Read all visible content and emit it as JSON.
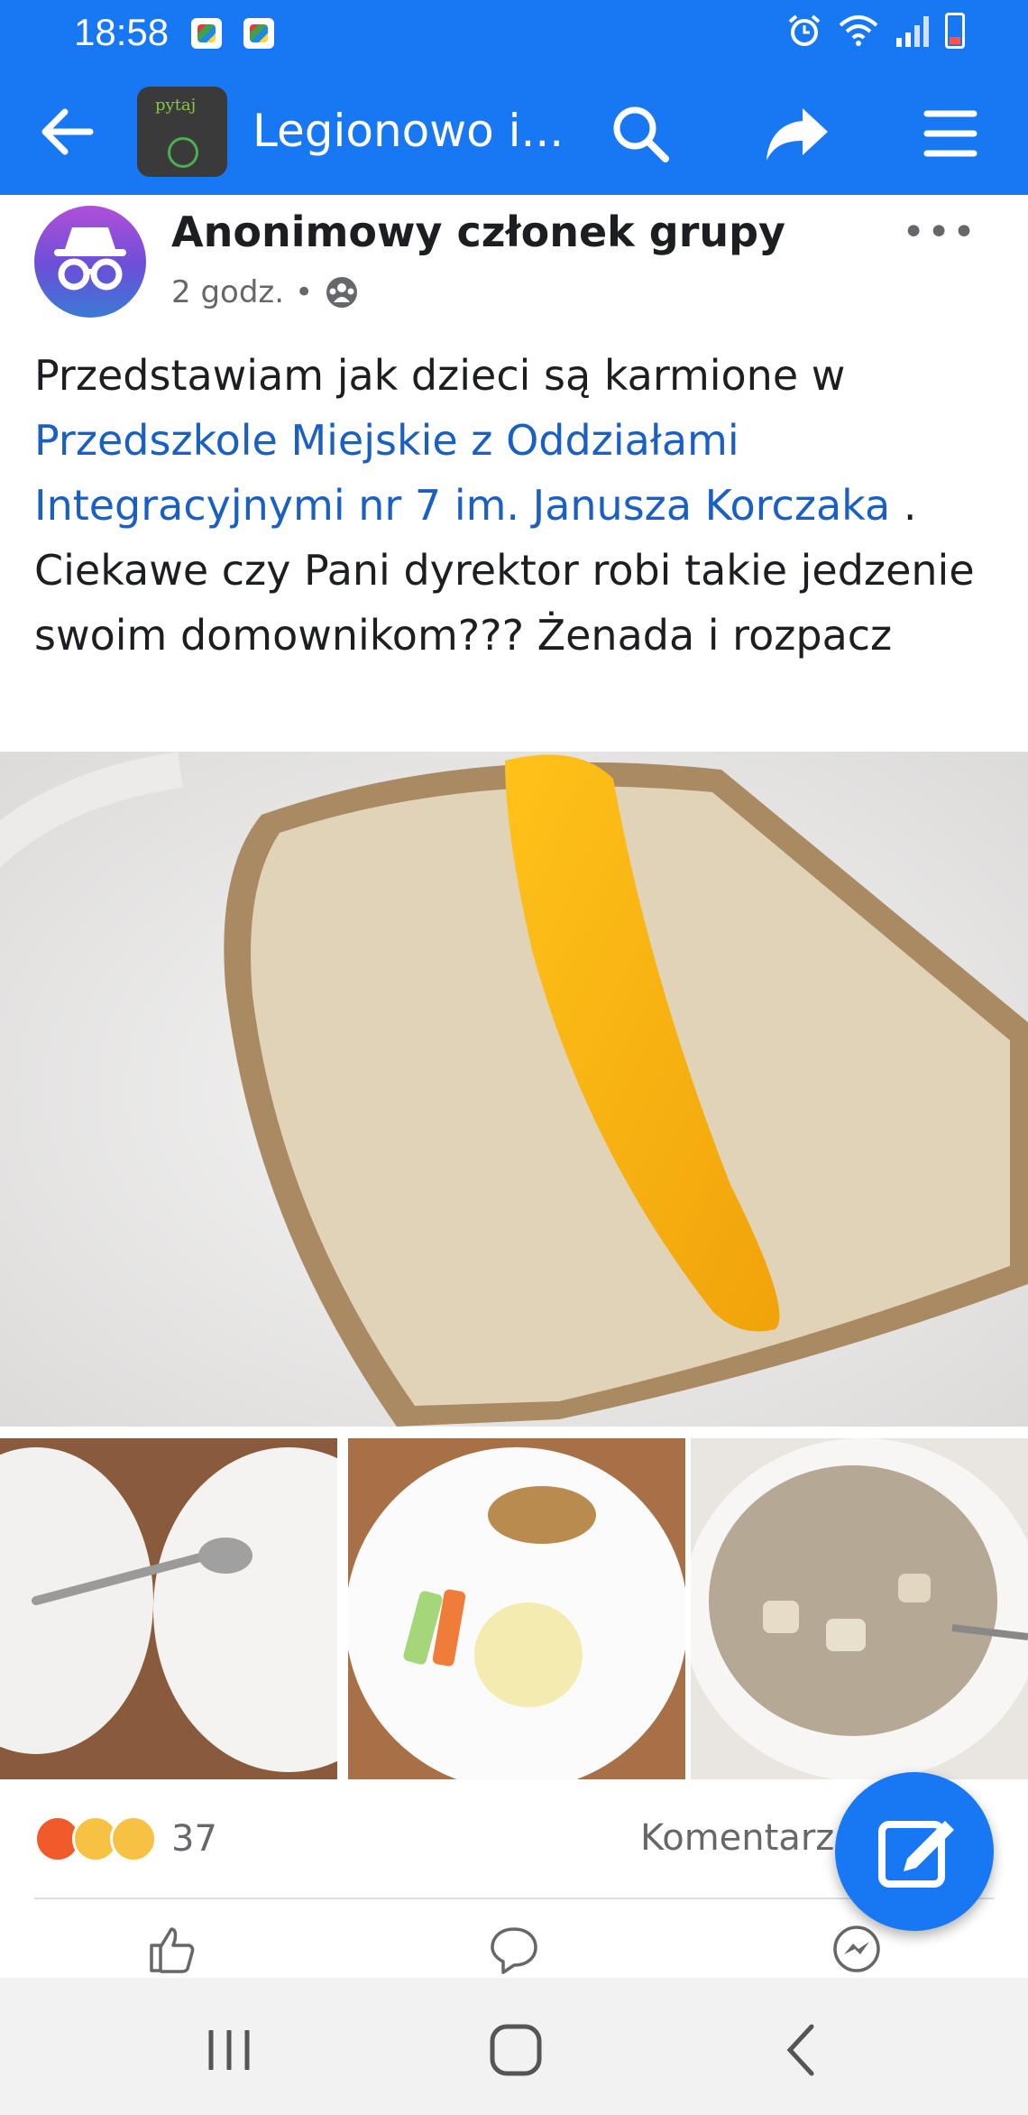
{
  "status_bar": {
    "time": "18:58",
    "accent": "#1877f2"
  },
  "app_bar": {
    "group_title": "Legionowo i...",
    "group_avatar_text": "pytaj",
    "icons": [
      "back-arrow-icon",
      "search-icon",
      "share-icon",
      "menu-icon"
    ]
  },
  "post": {
    "author": "Anonimowy członek grupy",
    "time": "2 godz.",
    "separator": "•",
    "audience_icon": "group-icon",
    "text_part1": "Przedstawiam jak dzieci są karmione w ",
    "link": "Przedszkole Miejskie z Oddziałami Integracyjnymi nr 7 im. Janusza Korczaka",
    "text_part2": " . Ciekawe czy Pani dyrektor robi takie jedzenie swoim domownikom??? Żenada i rozpacz",
    "link_color": "#1a5fc2"
  },
  "photos": {
    "main": "bread-with-pepper-photo",
    "thumbs": [
      "plates-photo",
      "meal-plate-photo",
      "soup-photo"
    ]
  },
  "footer": {
    "reaction_emojis": [
      "angry-emoji",
      "wow-emoji",
      "sad-emoji"
    ],
    "reaction_count": "37",
    "comments_label": "Komentarze",
    "actions": [
      "like-icon",
      "comment-icon",
      "messenger-icon"
    ]
  },
  "fab": {
    "icon": "compose-icon"
  },
  "nav": {
    "icons": [
      "recents-icon",
      "home-icon",
      "back-icon"
    ]
  }
}
